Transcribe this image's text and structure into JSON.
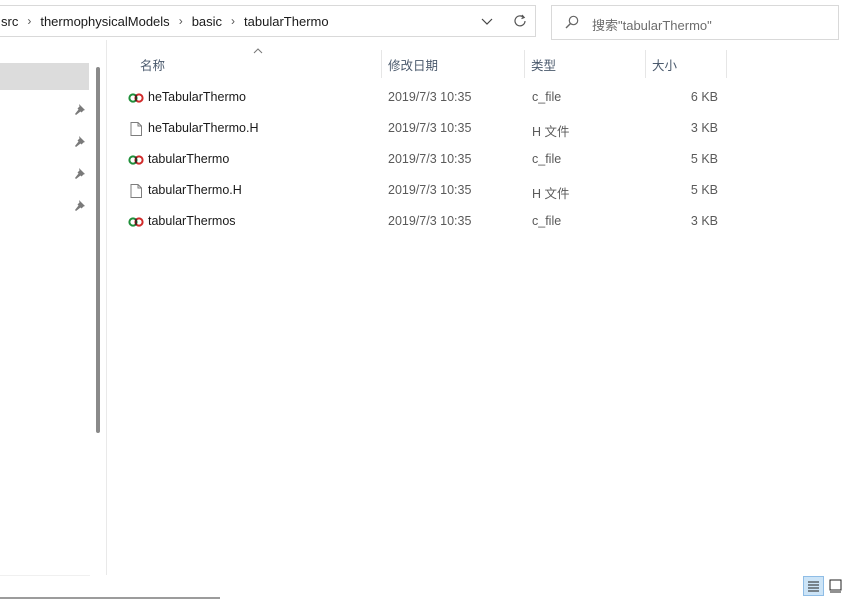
{
  "address_bar": {
    "crumbs": [
      "src",
      "thermophysicalModels",
      "basic",
      "tabularThermo"
    ]
  },
  "search": {
    "placeholder": "搜索\"tabularThermo\""
  },
  "columns": {
    "name": "名称",
    "date": "修改日期",
    "type": "类型",
    "size": "大小"
  },
  "files": [
    {
      "name": "heTabularThermo",
      "date": "2019/7/3 10:35",
      "type": "c_file",
      "size": "6 KB",
      "icon": "c-file-icon"
    },
    {
      "name": "heTabularThermo.H",
      "date": "2019/7/3 10:35",
      "type": "H 文件",
      "size": "3 KB",
      "icon": "blank-file-icon"
    },
    {
      "name": "tabularThermo",
      "date": "2019/7/3 10:35",
      "type": "c_file",
      "size": "5 KB",
      "icon": "c-file-icon"
    },
    {
      "name": "tabularThermo.H",
      "date": "2019/7/3 10:35",
      "type": "H 文件",
      "size": "5 KB",
      "icon": "blank-file-icon"
    },
    {
      "name": "tabularThermos",
      "date": "2019/7/3 10:35",
      "type": "c_file",
      "size": "3 KB",
      "icon": "c-file-icon"
    }
  ],
  "colors": {
    "selection": "#dcdcdc",
    "header_text": "#4b5a6d",
    "view_active": "#cce4f7"
  }
}
